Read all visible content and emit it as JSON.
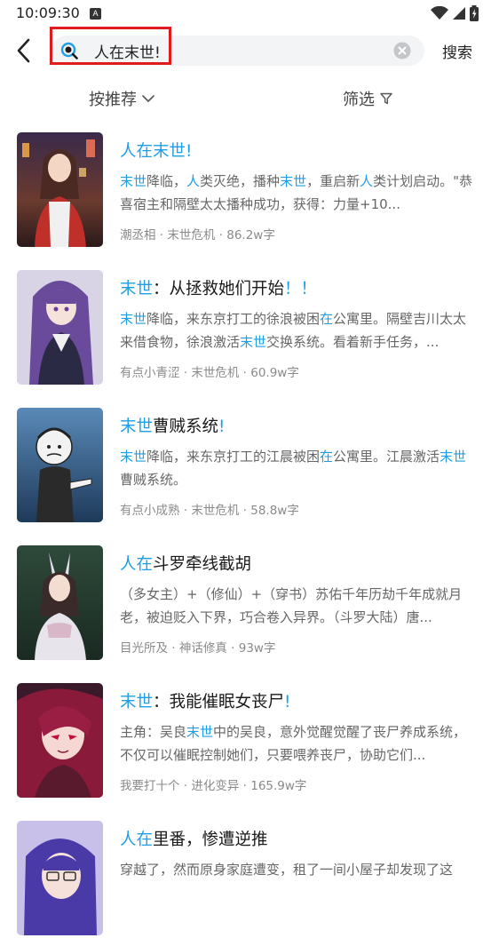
{
  "status_bar": {
    "time": "10:09:30",
    "notification_icon": "A"
  },
  "search": {
    "back_icon": "chevron-left-icon",
    "query": "人在末世!",
    "clear_icon": "clear-circle-icon",
    "submit_label": "搜索"
  },
  "filters": {
    "sort_label": "按推荐",
    "filter_label": "筛选"
  },
  "colors": {
    "highlight": "#1e9ee6",
    "annotation_box": "#e11b1b"
  },
  "books": [
    {
      "title": [
        {
          "t": "人在末世!",
          "h": true
        }
      ],
      "desc": [
        {
          "t": "末世",
          "h": true
        },
        {
          "t": "降临，",
          "h": false
        },
        {
          "t": "人",
          "h": true
        },
        {
          "t": "类灭绝，播种",
          "h": false
        },
        {
          "t": "末世",
          "h": true
        },
        {
          "t": "，重启新",
          "h": false
        },
        {
          "t": "人",
          "h": true
        },
        {
          "t": "类计划启动。\"恭喜宿主和隔壁太太播种成功，获得：力量+10...",
          "h": false
        }
      ],
      "meta": "潮丞相 · 末世危机 · 86.2w字"
    },
    {
      "title": [
        {
          "t": "末世",
          "h": true
        },
        {
          "t": "：从拯救她们开始",
          "h": false
        },
        {
          "t": "！！",
          "h": true
        }
      ],
      "desc": [
        {
          "t": "末世",
          "h": true
        },
        {
          "t": "降临，来东京打工的徐浪被困",
          "h": false
        },
        {
          "t": "在",
          "h": true
        },
        {
          "t": "公寓里。隔壁吉川太太来借食物，徐浪激活",
          "h": false
        },
        {
          "t": "末世",
          "h": true
        },
        {
          "t": "交换系统。看着新手任务，...",
          "h": false
        }
      ],
      "meta": "有点小青涩 · 末世危机 · 60.9w字"
    },
    {
      "title": [
        {
          "t": "末世",
          "h": true
        },
        {
          "t": "曹贼系统",
          "h": false
        },
        {
          "t": "!",
          "h": true
        }
      ],
      "desc": [
        {
          "t": "末世",
          "h": true
        },
        {
          "t": "降临，来东京打工的江晨被困",
          "h": false
        },
        {
          "t": "在",
          "h": true
        },
        {
          "t": "公寓里。江晨激活",
          "h": false
        },
        {
          "t": "末世",
          "h": true
        },
        {
          "t": "曹贼系统。",
          "h": false
        }
      ],
      "meta": "有点小成熟 · 末世危机 · 58.8w字"
    },
    {
      "title": [
        {
          "t": "人在",
          "h": true
        },
        {
          "t": "斗罗牵线截胡",
          "h": false
        }
      ],
      "desc": [
        {
          "t": "（多女主）+（修仙）+（穿书）苏佑千年历劫千年成就月老，被迫贬入下界，巧合卷入异界。（斗罗大陆）唐...",
          "h": false
        }
      ],
      "meta": "目光所及 · 神话修真 · 93w字"
    },
    {
      "title": [
        {
          "t": "末世",
          "h": true
        },
        {
          "t": "：我能催眠女丧尸",
          "h": false
        },
        {
          "t": "!",
          "h": true
        }
      ],
      "desc": [
        {
          "t": "主角：吴良",
          "h": false
        },
        {
          "t": "末世",
          "h": true
        },
        {
          "t": "中的吴良，意外觉醒觉醒了丧尸养成系统，不仅可以催眠控制她们，只要喂养丧尸，协助它们...",
          "h": false
        }
      ],
      "meta": "我要打十个 · 进化变异 · 165.9w字"
    },
    {
      "title": [
        {
          "t": "人在",
          "h": true
        },
        {
          "t": "里番，惨遭逆推",
          "h": false
        }
      ],
      "desc": [
        {
          "t": "穿越了，然而原身家庭遭变，租了一间小屋子却发现了这",
          "h": false
        }
      ],
      "meta": ""
    }
  ]
}
